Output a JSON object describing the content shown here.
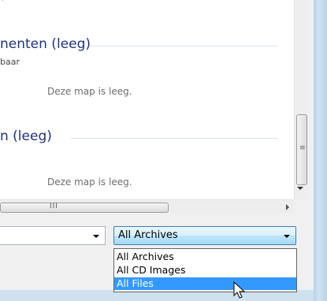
{
  "groups": [
    {
      "title": "nenten (leeg)",
      "subtitle": "baar",
      "empty_message": "Deze map is leeg."
    },
    {
      "title": "n (leeg)",
      "empty_message": "Deze map is leeg."
    }
  ],
  "top_mark": "'",
  "hscroll_grip": "III",
  "vscroll_grip": "≡",
  "filetype": {
    "selected": "All Archives",
    "options": [
      "All Archives",
      "All CD Images",
      "All Files"
    ],
    "highlighted_index": 2
  },
  "colors": {
    "group_title": "#1e3287",
    "highlight": "#3399ff",
    "select_border": "#3c7fb1"
  }
}
